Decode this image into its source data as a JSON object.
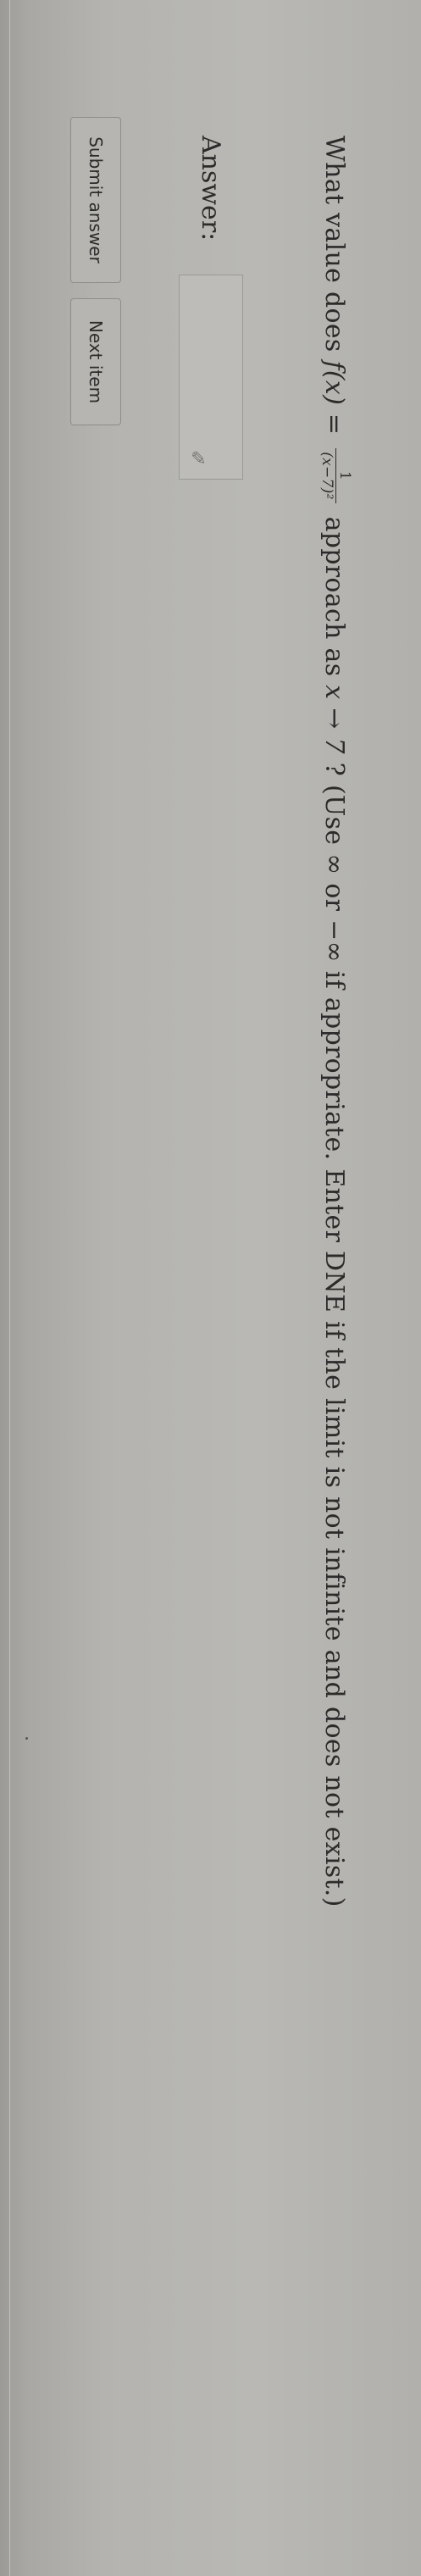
{
  "question": {
    "prefix": "What value does ",
    "fx": "f(x) =",
    "frac_num": "1",
    "frac_den": "(x−7)²",
    "middle": " approach as ",
    "limit": "x → 7",
    "suffix": "? (Use ∞ or −∞ if appropriate. Enter DNE if the limit is not infinite and does not exist.)"
  },
  "answer": {
    "label": "Answer:",
    "value": ""
  },
  "buttons": {
    "submit": "Submit answer",
    "next": "Next item"
  },
  "icons": {
    "answer_box_icon": "pencil-icon"
  }
}
